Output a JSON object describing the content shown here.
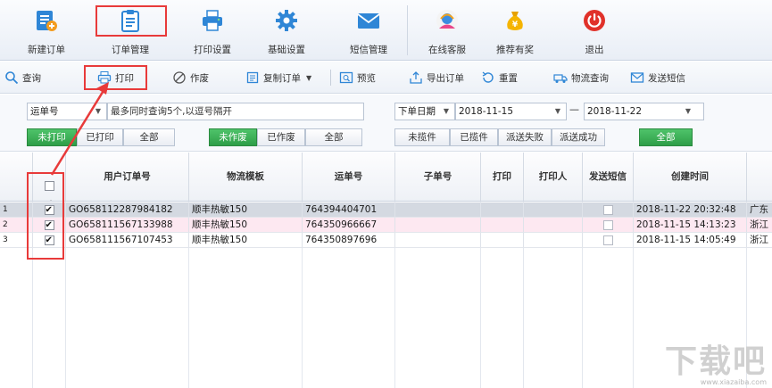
{
  "ribbon": {
    "items": [
      {
        "label": "新建订单",
        "icon": "new-order-icon"
      },
      {
        "label": "订单管理",
        "icon": "clipboard-icon"
      },
      {
        "label": "打印设置",
        "icon": "printer-icon"
      },
      {
        "label": "基础设置",
        "icon": "gear-icon"
      },
      {
        "label": "短信管理",
        "icon": "envelope-icon"
      },
      {
        "label": "在线客服",
        "icon": "support-icon"
      },
      {
        "label": "推荐有奖",
        "icon": "money-bag-icon"
      },
      {
        "label": "退出",
        "icon": "power-icon"
      }
    ]
  },
  "toolbar": {
    "query": "查询",
    "print": "打印",
    "void": "作废",
    "copy_order": "复制订单",
    "preview": "预览",
    "export_order": "导出订单",
    "reset": "重置",
    "logistics_query": "物流查询",
    "send_sms": "发送短信"
  },
  "filter": {
    "search_field": "运单号",
    "search_hint": "最多同时查询5个,以逗号隔开",
    "date_field": "下单日期",
    "date_from": "2018-11-15",
    "date_sep": "—",
    "date_to": "2018-11-22",
    "print_status": [
      "未打印",
      "已打印",
      "全部"
    ],
    "void_status": [
      "未作废",
      "已作废",
      "全部"
    ],
    "send_status": [
      "未揽件",
      "已揽件",
      "派送失败",
      "派送成功",
      "全部"
    ]
  },
  "grid": {
    "columns": [
      "",
      "用户订单号",
      "物流模板",
      "运单号",
      "子单号",
      "打印",
      "打印人",
      "发送短信",
      "创建时间",
      ""
    ],
    "rows": [
      {
        "num": "1",
        "checked": true,
        "order_no": "GO658112287984182",
        "template": "顺丰热敏150",
        "waybill": "764394404701",
        "sub": "",
        "print": "",
        "printer": "",
        "sms": false,
        "created": "2018-11-22 20:32:48",
        "extra": "广东"
      },
      {
        "num": "2",
        "checked": true,
        "order_no": "GO658111567133988",
        "template": "顺丰热敏150",
        "waybill": "764350966667",
        "sub": "",
        "print": "",
        "printer": "",
        "sms": false,
        "created": "2018-11-15 14:13:23",
        "extra": "浙江"
      },
      {
        "num": "3",
        "checked": true,
        "order_no": "GO658111567107453",
        "template": "顺丰热敏150",
        "waybill": "764350897696",
        "sub": "",
        "print": "",
        "printer": "",
        "sms": false,
        "created": "2018-11-15 14:05:49",
        "extra": "浙江"
      }
    ]
  },
  "watermark": {
    "big": "下载吧",
    "small": "www.xiazaiba.com"
  },
  "colors": {
    "accent_green": "#2e9e48",
    "highlight_red": "#e83a3a",
    "selected_row": "#d4d9e1"
  }
}
